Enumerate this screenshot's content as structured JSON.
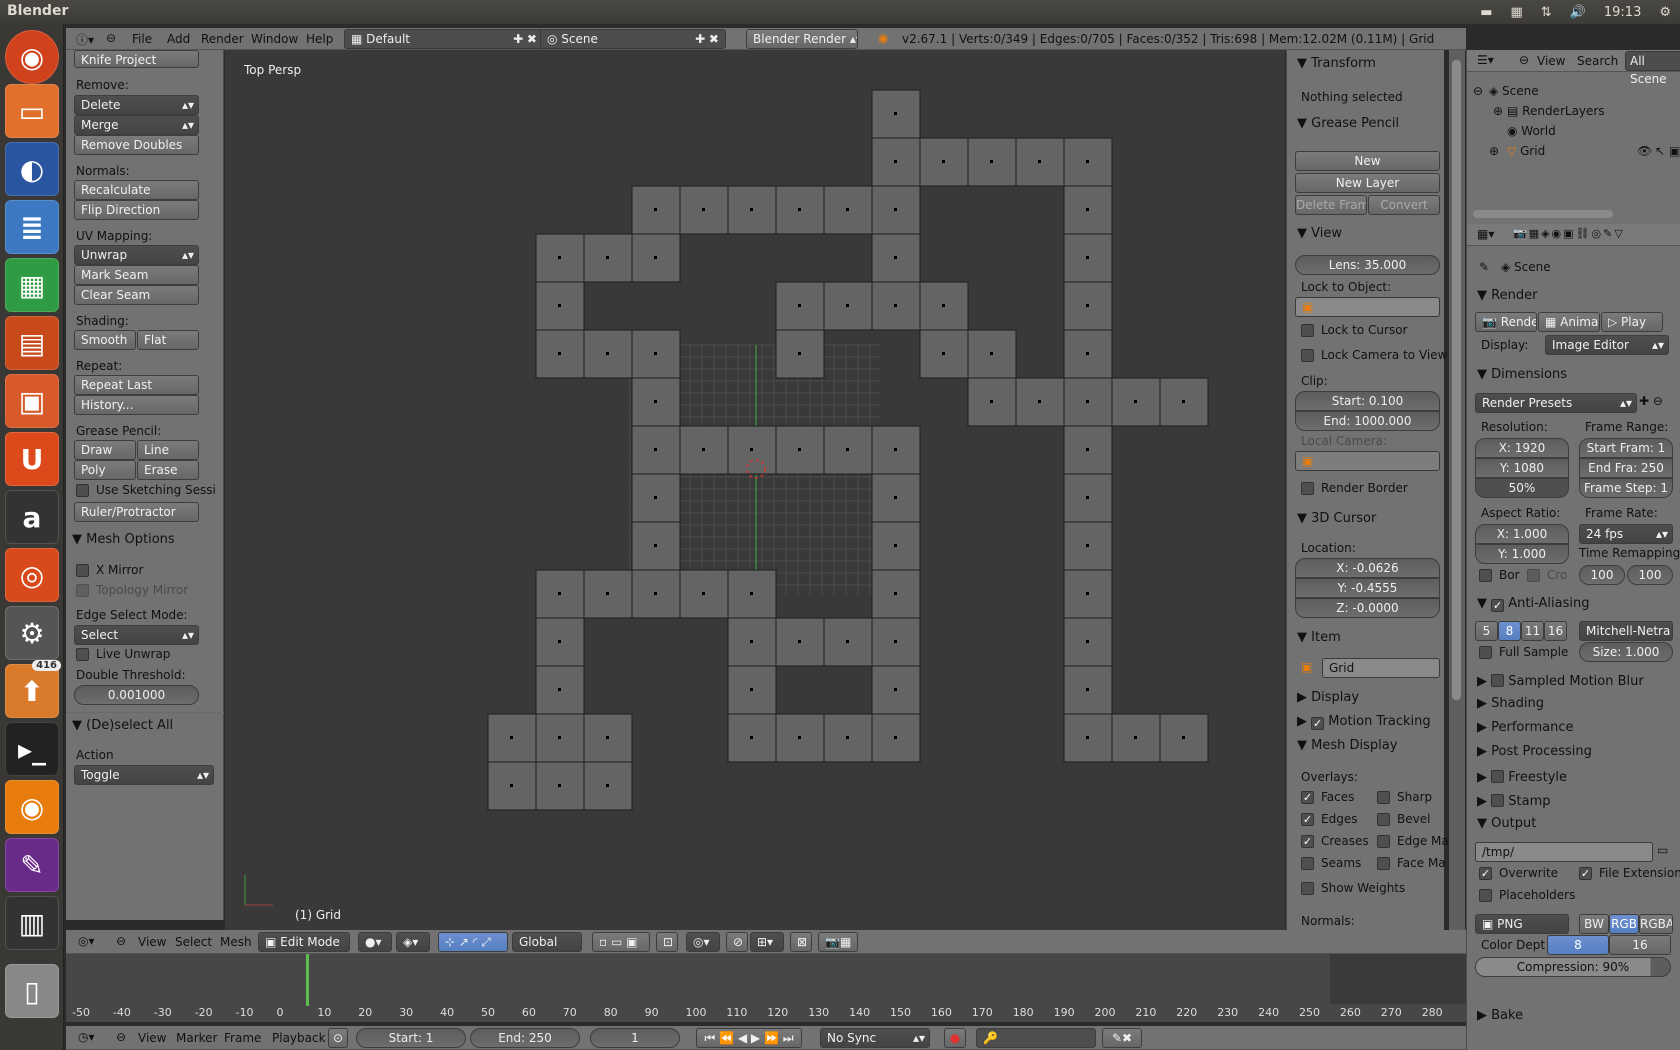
{
  "ubuntu": {
    "title": "Blender",
    "clock": "19:13",
    "launcher_badge": "416"
  },
  "info_header": {
    "menus": [
      "File",
      "Add",
      "Render",
      "Window",
      "Help"
    ],
    "layout": "Default",
    "scene": "Scene",
    "engine": "Blender Render",
    "stats": "v2.67.1 | Verts:0/349 | Edges:0/705 | Faces:0/352 | Tris:698 | Mem:12.02M (0.11M) | Grid"
  },
  "toolshelf": {
    "knife": "Knife Project",
    "remove_label": "Remove:",
    "delete": "Delete",
    "merge": "Merge",
    "remove_doubles": "Remove Doubles",
    "normals_label": "Normals:",
    "recalculate": "Recalculate",
    "flip": "Flip Direction",
    "uv_label": "UV Mapping:",
    "unwrap": "Unwrap",
    "mark_seam": "Mark Seam",
    "clear_seam": "Clear Seam",
    "shading_label": "Shading:",
    "smooth": "Smooth",
    "flat": "Flat",
    "repeat_label": "Repeat:",
    "repeat_last": "Repeat Last",
    "history": "History...",
    "gp_label": "Grease Pencil:",
    "draw": "Draw",
    "line": "Line",
    "poly": "Poly",
    "erase": "Erase",
    "sketch": "Use Sketching Sessi",
    "ruler": "Ruler/Protractor",
    "mesh_options": "Mesh Options",
    "x_mirror": "X Mirror",
    "topo_mirror": "Topology Mirror",
    "edge_select_mode": "Edge Select Mode:",
    "select": "Select",
    "live_unwrap": "Live Unwrap",
    "double_threshold": "Double Threshold:",
    "threshold_value": "0.001000",
    "deselect_all": "(De)select All",
    "action_label": "Action",
    "toggle": "Toggle"
  },
  "viewport": {
    "persp": "Top Persp",
    "object": "(1) Grid"
  },
  "props": {
    "transform": "Transform",
    "nothing_selected": "Nothing selected",
    "grease_pencil": "Grease Pencil",
    "new": "New",
    "new_layer": "New Layer",
    "delete_frame": "Delete Frame",
    "convert": "Convert",
    "view": "View",
    "lens": "Lens: 35.000",
    "lock_object": "Lock to Object:",
    "lock_cursor": "Lock to Cursor",
    "lock_camera": "Lock Camera to View",
    "clip": "Clip:",
    "clip_start": "Start: 0.100",
    "clip_end": "End: 1000.000",
    "local_camera": "Local Camera:",
    "render_border": "Render Border",
    "cursor_3d": "3D Cursor",
    "location": "Location:",
    "cx": "X: -0.0626",
    "cy": "Y: -0.4555",
    "cz": "Z: -0.0000",
    "item": "Item",
    "item_name": "Grid",
    "display": "Display",
    "motion_tracking": "Motion Tracking",
    "mesh_display": "Mesh Display",
    "overlays": "Overlays:",
    "faces": "Faces",
    "sharp": "Sharp",
    "edges": "Edges",
    "bevel": "Bevel",
    "creases": "Creases",
    "edge_ma": "Edge Ma",
    "seams": "Seams",
    "face_ma": "Face Ma",
    "show_weights": "Show Weights",
    "normals": "Normals:"
  },
  "outliner": {
    "view": "View",
    "search": "Search",
    "all_scenes": "All Scene",
    "scene": "Scene",
    "render_layers": "RenderLayers",
    "world": "World",
    "grid": "Grid"
  },
  "render": {
    "scene": "Scene",
    "render": "Render",
    "render_btn": "Render",
    "anim_btn": "Animatio",
    "play_btn": "Play",
    "display_label": "Display:",
    "display_value": "Image Editor",
    "dimensions": "Dimensions",
    "presets": "Render Presets",
    "resolution": "Resolution:",
    "rx": "X: 1920",
    "ry": "Y: 1080",
    "rpct": "50%",
    "frame_range": "Frame Range:",
    "start_frame": "Start Fram: 1",
    "end_frame": "End Fra: 250",
    "frame_step": "Frame Step: 1",
    "aspect": "Aspect Ratio:",
    "ax": "X: 1.000",
    "ay": "Y: 1.000",
    "frame_rate": "Frame Rate:",
    "fps": "24 fps",
    "time_remap": "Time Remapping:",
    "bor": "Bor",
    "cro": "Cro",
    "remap_old": "100",
    "remap_new": "100",
    "anti_aliasing": "Anti-Aliasing",
    "aa5": "5",
    "aa8": "8",
    "aa11": "11",
    "aa16": "16",
    "filter": "Mitchell-Netra",
    "full_sample": "Full Sample",
    "size": "Size: 1.000",
    "sampled_motion_blur": "Sampled Motion Blur",
    "shading": "Shading",
    "performance": "Performance",
    "post_processing": "Post Processing",
    "freestyle": "Freestyle",
    "stamp": "Stamp",
    "output": "Output",
    "path": "/tmp/",
    "overwrite": "Overwrite",
    "file_ext": "File Extension",
    "placeholders": "Placeholders",
    "format": "PNG",
    "bw": "BW",
    "rgb": "RGB",
    "rgba": "RGBA",
    "color_depth": "Color Dept",
    "cd8": "8",
    "cd16": "16",
    "compression": "Compression: 90%",
    "bake": "Bake"
  },
  "view3d_header": {
    "view": "View",
    "select": "Select",
    "mesh": "Mesh",
    "mode": "Edit Mode",
    "orientation": "Global"
  },
  "timeline": {
    "ticks": [
      "-50",
      "-40",
      "-30",
      "-20",
      "-10",
      "0",
      "10",
      "20",
      "30",
      "40",
      "50",
      "60",
      "70",
      "80",
      "90",
      "100",
      "110",
      "120",
      "130",
      "140",
      "150",
      "160",
      "170",
      "180",
      "190",
      "200",
      "210",
      "220",
      "230",
      "240",
      "250",
      "260",
      "270",
      "280"
    ],
    "view": "View",
    "marker": "Marker",
    "frame": "Frame",
    "playback": "Playback",
    "start": "Start: 1",
    "end": "End: 250",
    "current": "1",
    "sync": "No Sync"
  },
  "colors": {
    "panel": "#727272",
    "viewport": "#393939",
    "face": "#646464"
  }
}
